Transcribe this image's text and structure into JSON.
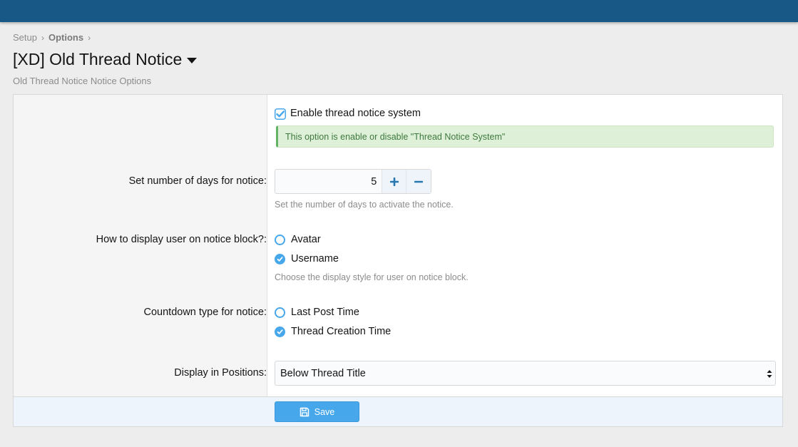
{
  "breadcrumb": {
    "items": [
      "Setup",
      "Options"
    ]
  },
  "page": {
    "title": "[XD] Old Thread Notice",
    "description": "Old Thread Notice Notice Options"
  },
  "options": {
    "enable": {
      "label": "Enable thread notice system",
      "checked": true,
      "hint": "This option is enable or disable \"Thread Notice System\""
    },
    "days": {
      "label": "Set number of days for notice:",
      "value": "5",
      "explain": "Set the number of days to activate the notice."
    },
    "display_user": {
      "label": "How to display user on notice block?:",
      "choices": [
        "Avatar",
        "Username"
      ],
      "selected": "Username",
      "explain": "Choose the display style for user on notice block."
    },
    "countdown": {
      "label": "Countdown type for notice:",
      "choices": [
        "Last Post Time",
        "Thread Creation Time"
      ],
      "selected": "Thread Creation Time"
    },
    "positions": {
      "label": "Display in Positions:",
      "selected": "Below Thread Title"
    }
  },
  "footer": {
    "save_label": "Save"
  },
  "colors": {
    "topbar": "#185886",
    "accent": "#47a7eb",
    "hint_bg": "#dff0d8",
    "hint_text": "#3d793f"
  },
  "icons": {
    "title_menu": "caret-down-icon",
    "checkbox": "checkmark-icon",
    "stepper_up": "plus-icon",
    "stepper_down": "minus-icon",
    "save": "floppy-disk-icon"
  }
}
